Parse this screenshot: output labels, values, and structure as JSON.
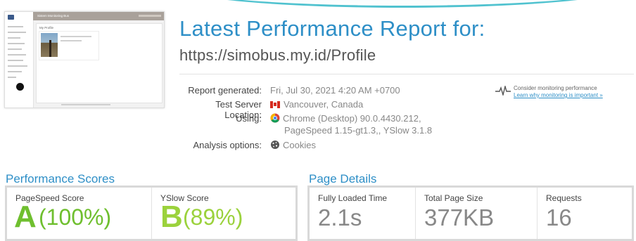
{
  "thumbnail": {
    "app_title": "Sistem Monitoring Bus",
    "page_title": "My Profile"
  },
  "report": {
    "heading": "Latest Performance Report for:",
    "url": "https://simobus.my.id/Profile",
    "details": {
      "generated_label": "Report generated:",
      "generated_value": "Fri, Jul 30, 2021 4:20 AM +0700",
      "location_label": "Test Server Location:",
      "location_value": "Vancouver, Canada",
      "using_label": "Using:",
      "using_value_1": "Chrome (Desktop) 90.0.4430.212,",
      "using_value_2": "PageSpeed 1.15-gt1.3,, YSlow 3.1.8",
      "options_label": "Analysis options:",
      "options_value": "Cookies"
    },
    "monitoring": {
      "text": "Consider monitoring performance",
      "link": "Learn why monitoring is important »"
    }
  },
  "performance": {
    "title": "Performance Scores",
    "pagespeed": {
      "label": "PageSpeed Score",
      "grade": "A",
      "percent": "(100%)",
      "color": "#6fbf2f"
    },
    "yslow": {
      "label": "YSlow Score",
      "grade": "B",
      "percent": "(89%)",
      "color": "#9bd23c"
    }
  },
  "page_details": {
    "title": "Page Details",
    "loaded": {
      "label": "Fully Loaded Time",
      "value": "2.1s"
    },
    "size": {
      "label": "Total Page Size",
      "value": "377KB"
    },
    "requests": {
      "label": "Requests",
      "value": "16"
    }
  },
  "colors": {
    "accent": "#2e8fc7",
    "arc": "#4fc2cf"
  }
}
